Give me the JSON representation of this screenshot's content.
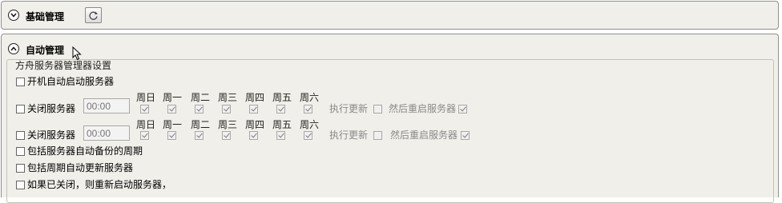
{
  "panels": {
    "basic": {
      "title": "基础管理",
      "expanded": false
    },
    "auto": {
      "title": "自动管理",
      "expanded": true
    }
  },
  "settings_group": {
    "legend": "方舟服务器管理器设置",
    "autostart_label": "开机自动启动服务器",
    "shutdown_rows": [
      {
        "label": "关闭服务器",
        "time_value": "00:00",
        "days": [
          "周日",
          "周一",
          "周二",
          "周三",
          "周四",
          "周五",
          "周六"
        ],
        "update_label": "执行更新",
        "restart_label": "然后重启服务器"
      },
      {
        "label": "关闭服务器",
        "time_value": "00:00",
        "days": [
          "周日",
          "周一",
          "周二",
          "周三",
          "周四",
          "周五",
          "周六"
        ],
        "update_label": "执行更新",
        "restart_label": "然后重启服务器"
      }
    ],
    "include_backup_label": "包括服务器自动备份的周期",
    "include_update_label": "包括周期自动更新服务器",
    "restart_if_closed_label": "如果已关闭，则重新启动服务器，"
  },
  "icons": {
    "expand": "chevron-down-icon",
    "collapse": "chevron-up-icon",
    "refresh": "refresh-icon",
    "cursor": "mouse-pointer-icon"
  }
}
